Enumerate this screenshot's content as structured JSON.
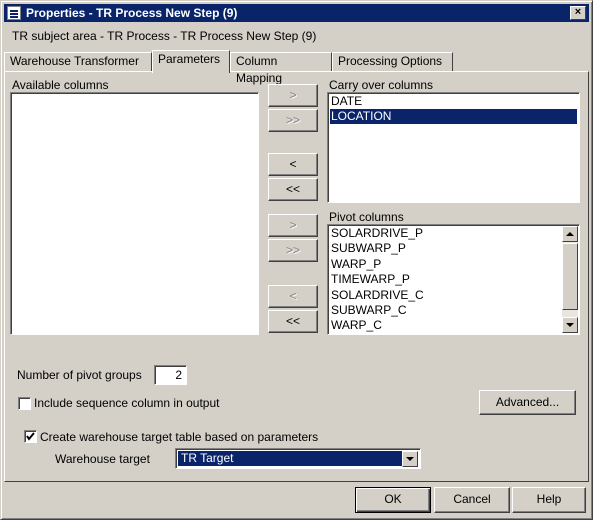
{
  "window": {
    "title": "Properties - TR Process New Step (9)",
    "close_glyph": "×"
  },
  "subject_line": "TR subject area - TR Process - TR Process New Step (9)",
  "tabs": [
    "Warehouse Transformer",
    "Parameters",
    "Column Mapping",
    "Processing Options"
  ],
  "active_tab": "Parameters",
  "available_columns": {
    "label": "Available columns",
    "items": []
  },
  "carry_over": {
    "label": "Carry over columns",
    "items": [
      "DATE",
      "LOCATION"
    ],
    "selected": "LOCATION"
  },
  "pivot": {
    "label": "Pivot columns",
    "items": [
      "SOLARDRIVE_P",
      "SUBWARP_P",
      "WARP_P",
      "TIMEWARP_P",
      "SOLARDRIVE_C",
      "SUBWARP_C",
      "WARP_C"
    ]
  },
  "move_buttons": {
    "add_one": ">",
    "add_all": ">>",
    "remove_one": "<",
    "remove_all": "<<"
  },
  "pivot_groups": {
    "label": "Number of pivot groups",
    "value": "2"
  },
  "sequence_col": {
    "label": "Include sequence column in output",
    "checked": false
  },
  "advanced_button": "Advanced...",
  "create_table": {
    "label": "Create warehouse target table based on parameters",
    "checked": true
  },
  "warehouse_target": {
    "label": "Warehouse target",
    "value": "TR Target"
  },
  "footer": {
    "ok": "OK",
    "cancel": "Cancel",
    "help": "Help"
  },
  "colors": {
    "selection": "#0a246a",
    "face": "#d4d0c8",
    "titlebar": "#0a246a"
  }
}
